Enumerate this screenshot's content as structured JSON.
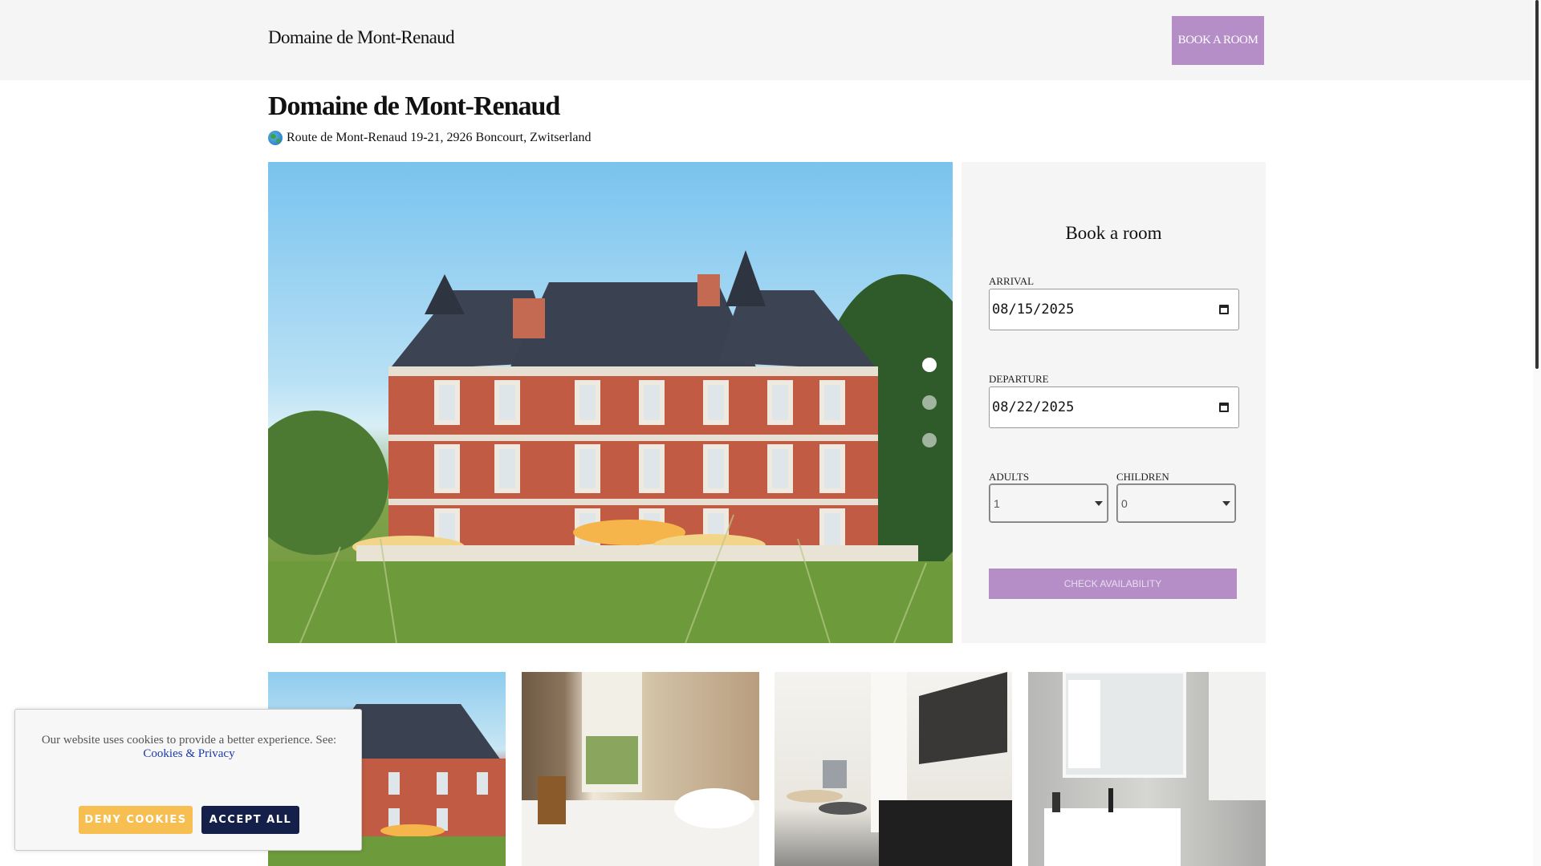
{
  "header": {
    "brand": "Domaine de Mont-Renaud",
    "book_button": "BOOK A ROOM"
  },
  "hotel": {
    "title": "Domaine de Mont-Renaud",
    "address": "Route de Mont-Renaud 19-21, 2926 Boncourt, Zwitserland",
    "address_icon": "globe-icon"
  },
  "carousel": {
    "slide_count": 3,
    "active_slide": 1
  },
  "booking": {
    "title": "Book a room",
    "arrival_label": "ARRIVAL",
    "arrival_value": "08/15/2025",
    "departure_label": "DEPARTURE",
    "departure_value": "08/22/2025",
    "adults_label": "ADULTS",
    "adults_value": "1",
    "children_label": "CHILDREN",
    "children_value": "0",
    "check_button": "CHECK AVAILABILITY",
    "accent_color": "#b58ec7"
  },
  "gallery": {
    "items": [
      "chateau-exterior",
      "bedroom",
      "living-area",
      "bathroom"
    ]
  },
  "cookie_banner": {
    "text": "Our website uses cookies to provide a better experience. See:",
    "link": "Cookies & Privacy",
    "deny_button": "DENY COOKIES",
    "accept_button": "ACCEPT ALL",
    "deny_color": "#f7bf52",
    "accept_color": "#15204a"
  }
}
